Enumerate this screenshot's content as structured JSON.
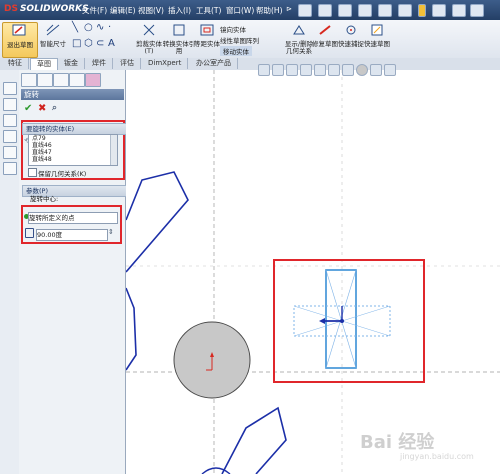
{
  "app": {
    "name": "SOLIDWORKS"
  },
  "menu": [
    "文件(F)",
    "编辑(E)",
    "视图(V)",
    "插入(I)",
    "工具(T)",
    "窗口(W)",
    "帮助(H)"
  ],
  "ribbon": {
    "exit_sketch": "退出草图",
    "smart_dim": "智能尺寸",
    "trim": "剪裁实体(T)",
    "convert": "转换实体引用",
    "offset": "等距实体",
    "mirror": "镜向实体",
    "linear_pattern": "线性草图阵列",
    "move": "移动实体",
    "show_delete": "显示/删除几何关系",
    "repair": "修复草图",
    "quick_snap": "快速捕捉",
    "rapid_sketch": "快速草图"
  },
  "tabs": [
    "特征",
    "草图",
    "钣金",
    "焊件",
    "评估",
    "DimXpert",
    "办公室产品"
  ],
  "panel": {
    "title": "旋转",
    "ok": "✔",
    "cancel": "✖",
    "entities_group": "要旋转的实体(E)",
    "entities": [
      "点79",
      "直线46",
      "直线47",
      "直线48"
    ],
    "keep_relations": "保留几何关系(K)",
    "params_group": "参数(P)",
    "center_label": "旋转中心:",
    "center_value": "旋转所定义的点",
    "angle_value": "90.00度"
  },
  "watermark": {
    "brand": "Bai 经验",
    "url": "jingyan.baidu.com"
  },
  "colors": {
    "highlight": "#e0262b",
    "sketch_line": "#1c2fa8",
    "selected": "#3a8fd6",
    "circle_fill": "#c8c8c8"
  }
}
